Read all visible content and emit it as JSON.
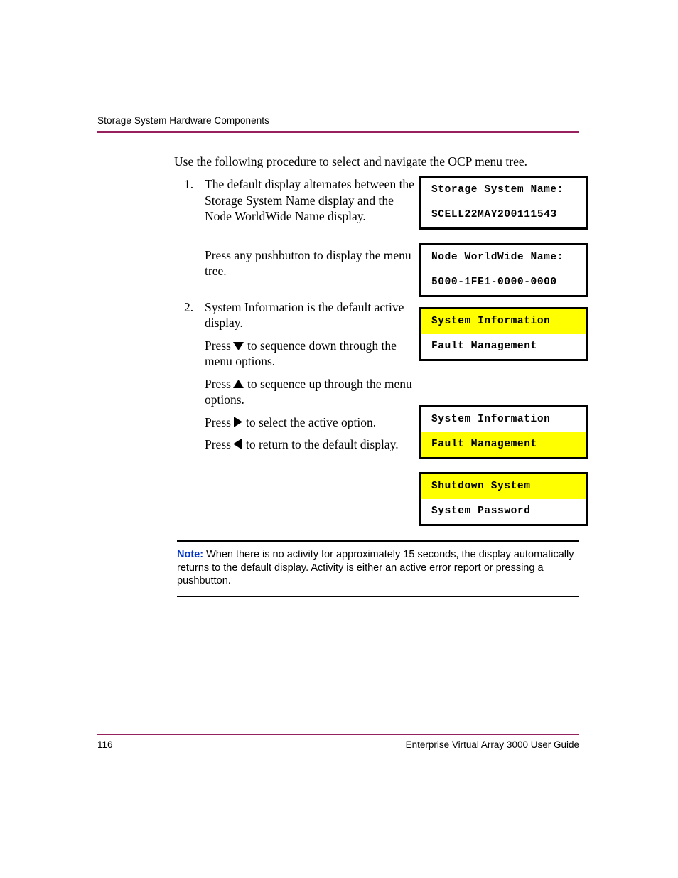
{
  "header": {
    "title": "Storage System Hardware Components",
    "rule_color": "#97205F"
  },
  "intro": {
    "text": "Use the following procedure to select and navigate the OCP menu tree."
  },
  "steps": [
    {
      "number": "1.",
      "paragraphs": [
        "The default display alternates between the Storage System Name display and the Node WorldWide Name display.",
        "Press any pushbutton to display the menu tree."
      ]
    },
    {
      "number": "2.",
      "paragraphs": [
        "System Information is the default active display."
      ],
      "press_lines": [
        {
          "prefix": "Press",
          "icon": "triangle-down-icon",
          "suffix": "to sequence down through the menu options."
        },
        {
          "prefix": "Press",
          "icon": "triangle-up-icon",
          "suffix": "to sequence up through the menu options."
        },
        {
          "prefix": "Press",
          "icon": "triangle-right-icon",
          "suffix": "to select the active option."
        },
        {
          "prefix": "Press",
          "icon": "triangle-left-icon",
          "suffix": "to return to the default display."
        }
      ]
    }
  ],
  "lcd_displays": [
    {
      "id": "storage-name",
      "rows": [
        {
          "text": "Storage System Name:",
          "highlighted": false
        },
        {
          "text": "SCELL22MAY200111543",
          "highlighted": false
        }
      ]
    },
    {
      "id": "node-wwn",
      "rows": [
        {
          "text": "Node WorldWide Name:",
          "highlighted": false
        },
        {
          "text": "5000-1FE1-0000-0000",
          "highlighted": false
        }
      ]
    },
    {
      "id": "menu-sysinfo",
      "rows": [
        {
          "text": "System Information",
          "highlighted": true
        },
        {
          "text": "Fault Management",
          "highlighted": false
        }
      ]
    },
    {
      "id": "menu-fault",
      "rows": [
        {
          "text": "System Information",
          "highlighted": false
        },
        {
          "text": "Fault Management",
          "highlighted": true
        }
      ]
    },
    {
      "id": "menu-shutdown",
      "rows": [
        {
          "text": "Shutdown System",
          "highlighted": true
        },
        {
          "text": "System Password",
          "highlighted": false
        }
      ]
    }
  ],
  "note": {
    "label": "Note:",
    "label_color": "#0033CC",
    "text": "When there is no activity for approximately 15 seconds, the display automatically returns to the default display. Activity is either an active error report or pressing a pushbutton."
  },
  "footer": {
    "page_number": "116",
    "guide_title": "Enterprise Virtual Array 3000 User Guide",
    "rule_color": "#97205F"
  },
  "highlight_color": "#FFFF00"
}
